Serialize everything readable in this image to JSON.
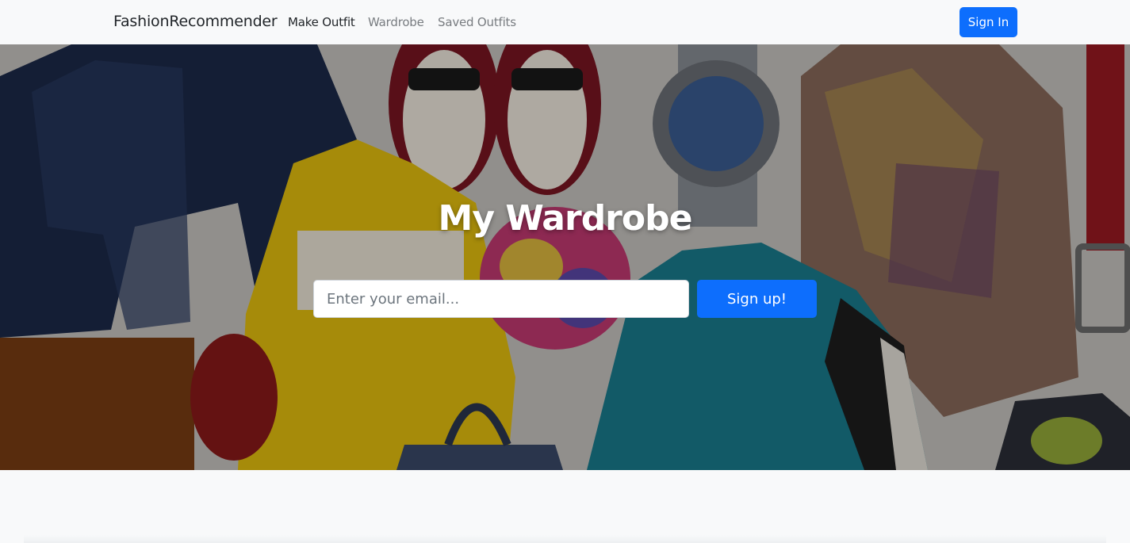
{
  "navbar": {
    "brand": "FashionRecommender",
    "links": [
      {
        "label": "Make Outfit",
        "active": true
      },
      {
        "label": "Wardrobe",
        "active": false
      },
      {
        "label": "Saved Outfits",
        "active": false
      }
    ],
    "signin_label": "Sign In"
  },
  "hero": {
    "title": "My Wardrobe",
    "email_placeholder": "Enter your email...",
    "signup_label": "Sign up!"
  },
  "colors": {
    "primary": "#0d6efd",
    "navbar_bg": "#f8f9fa"
  }
}
